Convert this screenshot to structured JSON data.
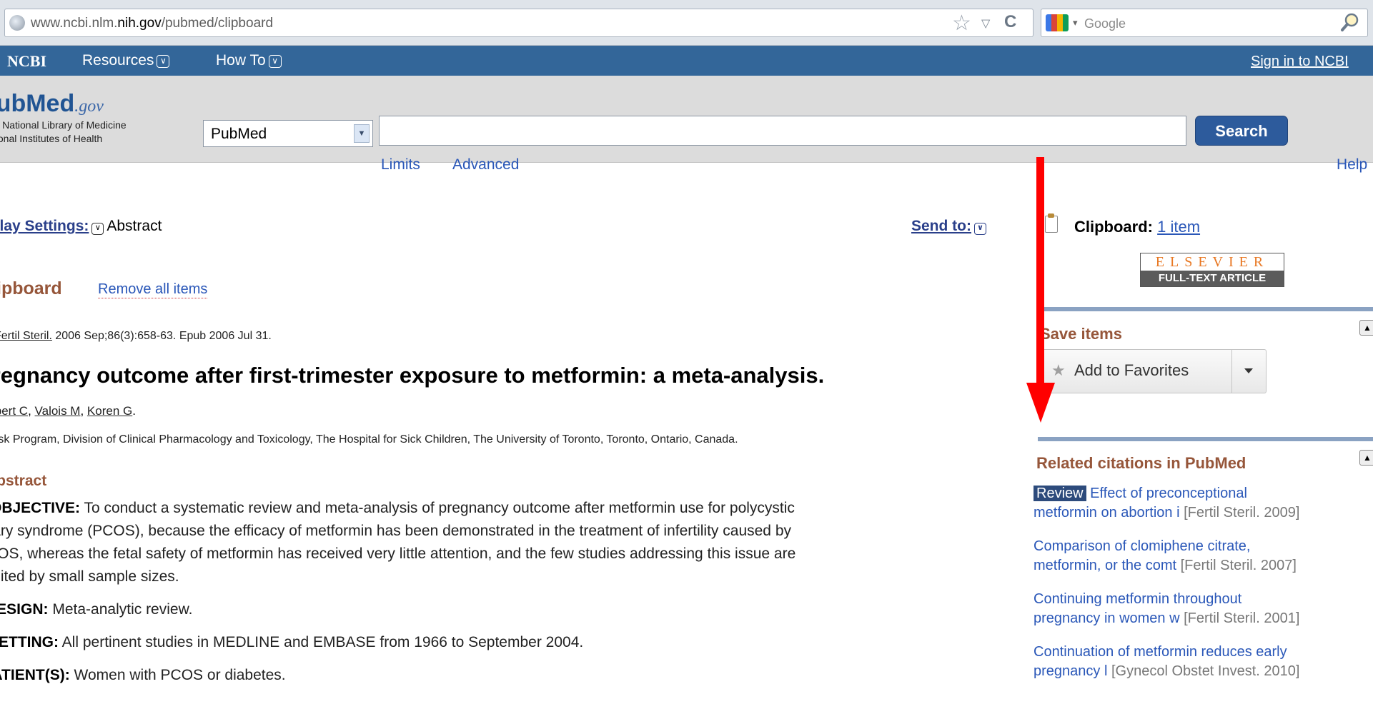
{
  "browser": {
    "url_prefix": "www.ncbi.nlm.",
    "url_domain": "nih.gov",
    "url_path": "/pubmed/clipboard",
    "search_placeholder": "Google"
  },
  "ncbi_nav": {
    "brand": "NCBI",
    "resources": "Resources",
    "how_to": "How To",
    "sign_in": "Sign in to NCBI"
  },
  "pubmed_header": {
    "logo_text": "PubMed",
    "logo_gov": ".gov",
    "logo_line1": "U.S. National Library of Medicine",
    "logo_line2": "National Institutes of Health",
    "database": "PubMed",
    "search_value": "",
    "search_button": "Search",
    "limits": "Limits",
    "advanced": "Advanced",
    "help": "Help"
  },
  "display": {
    "settings_label": "Display Settings:",
    "format": "Abstract",
    "send_to": "Send to:"
  },
  "clipboard_section": {
    "heading": "Clipboard",
    "remove_all": "Remove all items"
  },
  "article": {
    "journal": "Fertil Steril.",
    "citation_rest": " 2006 Sep;86(3):658-63. Epub 2006 Jul 31.",
    "title": "Pregnancy outcome after first-trimester exposure to metformin: a meta-analysis.",
    "authors": [
      "Gilbert C",
      "Valois M",
      "Koren G"
    ],
    "affiliation": "The Motherisk Program, Division of Clinical Pharmacology and Toxicology, The Hospital for Sick Children, The University of Toronto, Toronto, Ontario, Canada.",
    "abstract_heading": "Abstract",
    "objective_label": "OBJECTIVE:",
    "objective_l1": " To conduct a systematic review and meta-analysis of pregnancy outcome after metformin use for polycystic",
    "objective_l2": "ovary syndrome (PCOS), because the efficacy of metformin has been demonstrated in the treatment of infertility caused by",
    "objective_l3": "PCOS, whereas the fetal safety of metformin has received very little attention, and the few studies addressing this issue are",
    "objective_l4": "limited by small sample sizes.",
    "design_label": "DESIGN:",
    "design_text": " Meta-analytic review.",
    "setting_label": "SETTING:",
    "setting_text": " All pertinent studies in MEDLINE and EMBASE from 1966 to September 2004.",
    "patients_label": "PATIENT(S):",
    "patients_text": " Women with PCOS or diabetes."
  },
  "sidebar": {
    "clipboard_label": "Clipboard:",
    "clipboard_count": "1 item",
    "elsevier_top": "ELSEVIER",
    "elsevier_bottom": "FULL-TEXT ARTICLE",
    "save_items": "Save items",
    "add_favorites": "Add to Favorites",
    "related_title": "Related citations in PubMed",
    "related": [
      {
        "badge": "Review",
        "line1": "Effect of preconceptional",
        "line2": "metformin on abortion i",
        "src": "[Fertil Steril. 2009]"
      },
      {
        "badge": "",
        "line1": "Comparison of clomiphene citrate,",
        "line2": "metformin, or the comt",
        "src": "[Fertil Steril. 2007]"
      },
      {
        "badge": "",
        "line1": "Continuing metformin throughout",
        "line2": "pregnancy in women w",
        "src": "[Fertil Steril. 2001]"
      },
      {
        "badge": "",
        "line1": "Continuation of metformin reduces early",
        "line2": "pregnancy l",
        "src": "[Gynecol Obstet Invest. 2010]"
      }
    ]
  },
  "colors": {
    "ncbi_blue": "#336699",
    "heading_brown": "#96563a",
    "link_blue": "#2a57b8",
    "arrow_red": "#ff0000"
  }
}
